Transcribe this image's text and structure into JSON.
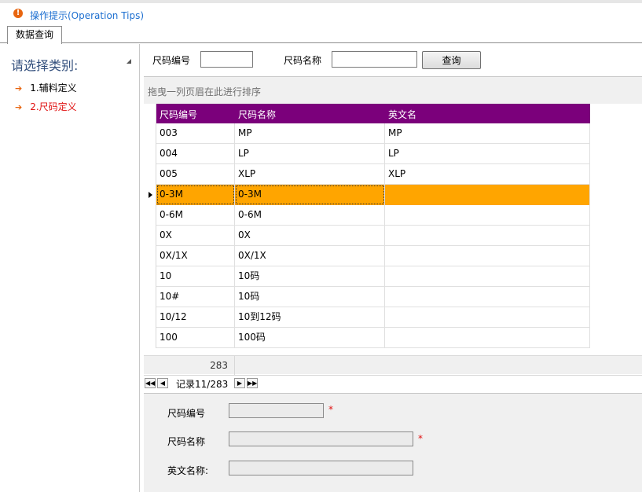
{
  "header": {
    "tip": "操作提示(Operation Tips)"
  },
  "tabs": [
    {
      "label": "数据查询"
    }
  ],
  "left": {
    "title": "请选择类别:",
    "items": [
      {
        "label": "1.辅料定义"
      },
      {
        "label": "2.尺码定义"
      }
    ]
  },
  "search": {
    "code_label": "尺码编号",
    "code_value": "",
    "name_label": "尺码名称",
    "name_value": "",
    "query_label": "查询"
  },
  "grid": {
    "group_hint": "拖曳一列页眉在此进行排序",
    "columns": [
      "尺码编号",
      "尺码名称",
      "英文名"
    ],
    "rows": [
      [
        "003",
        "MP",
        "MP"
      ],
      [
        "004",
        "LP",
        "LP"
      ],
      [
        "005",
        "XLP",
        "XLP"
      ],
      [
        "0-3M",
        "0-3M",
        ""
      ],
      [
        "0-6M",
        "0-6M",
        ""
      ],
      [
        "0X",
        "0X",
        ""
      ],
      [
        "0X/1X",
        "0X/1X",
        ""
      ],
      [
        "10",
        "10码",
        ""
      ],
      [
        "10#",
        "10码",
        ""
      ],
      [
        "10/12",
        "10到12码",
        ""
      ],
      [
        "100",
        "100码",
        ""
      ]
    ],
    "selected_row": 3,
    "total_count": "283",
    "record_text": "记录11/283"
  },
  "edit": {
    "code_label": "尺码编号",
    "name_label": "尺码名称",
    "en_label": "英文名称:",
    "required_mark": "*"
  }
}
